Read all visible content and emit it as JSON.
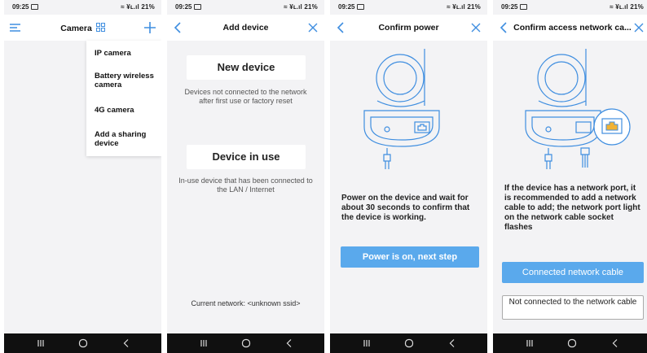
{
  "status": {
    "time": "09:25",
    "battery": "21%",
    "signal_text": "≈ ¥ʟ.ıl"
  },
  "colors": {
    "accent": "#3f8ee0",
    "primary_button": "#5aa9ec",
    "navbar": "#101010"
  },
  "screen1": {
    "title": "Camera",
    "menu": [
      "IP camera",
      "Battery wireless camera",
      "4G camera",
      "Add a sharing device"
    ]
  },
  "screen2": {
    "title": "Add device",
    "new_device": {
      "label": "New device",
      "desc": "Devices not connected to the network after first use or factory reset"
    },
    "device_in_use": {
      "label": "Device in use",
      "desc": "In-use device that has been connected to the LAN / Internet"
    },
    "network": "Current network: <unknown ssid>"
  },
  "screen3": {
    "title": "Confirm power",
    "instruction": "Power on the device and wait for about 30 seconds to confirm that the device is working.",
    "button": "Power is on, next step"
  },
  "screen4": {
    "title": "Confirm access network ca...",
    "instruction": "If the device has a network port, it is recommended to add a network cable to add; the network port light on the network cable socket flashes",
    "primary_button": "Connected network cable",
    "secondary_button": "Not connected to the network cable"
  }
}
